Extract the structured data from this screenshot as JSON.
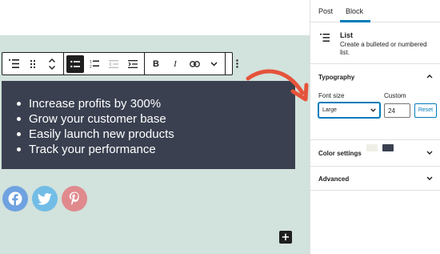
{
  "toolbar": {
    "buttons": [
      "list-icon",
      "drag-handle-icon",
      "move-up-down-icon",
      "unordered-list-icon",
      "ordered-list-icon",
      "outdent-icon",
      "indent-icon",
      "bold-icon",
      "italic-icon",
      "link-icon",
      "chevron-down-icon",
      "more-options-icon"
    ],
    "bold_label": "B",
    "italic_label": "I"
  },
  "list": {
    "items": [
      "Increase profits by 300%",
      "Grow your customer base",
      "Easily launch new products",
      "Track your performance"
    ],
    "background_color": "#3a4050",
    "text_color": "#ffffff"
  },
  "social": [
    {
      "name": "facebook-icon",
      "color": "#1877f2"
    },
    {
      "name": "twitter-icon",
      "color": "#1da1f2"
    },
    {
      "name": "pinterest-icon",
      "color": "#e60023"
    }
  ],
  "canvas": {
    "background_color": "#d2e2dc",
    "add_block_label": "+"
  },
  "sidebar": {
    "tabs": [
      {
        "label": "Post"
      },
      {
        "label": "Block"
      }
    ],
    "block": {
      "title": "List",
      "description": "Create a bulleted or numbered list."
    },
    "typography": {
      "title": "Typography",
      "font_size_label": "Font size",
      "custom_label": "Custom",
      "selected_size": "Large",
      "custom_value": "24",
      "reset_label": "Reset"
    },
    "color_settings": {
      "title": "Color settings",
      "swatches": [
        "#efefe6",
        "#3a4050"
      ]
    },
    "advanced": {
      "title": "Advanced"
    }
  },
  "accent_color": "#007cba",
  "arrow_color": "#e5533b"
}
